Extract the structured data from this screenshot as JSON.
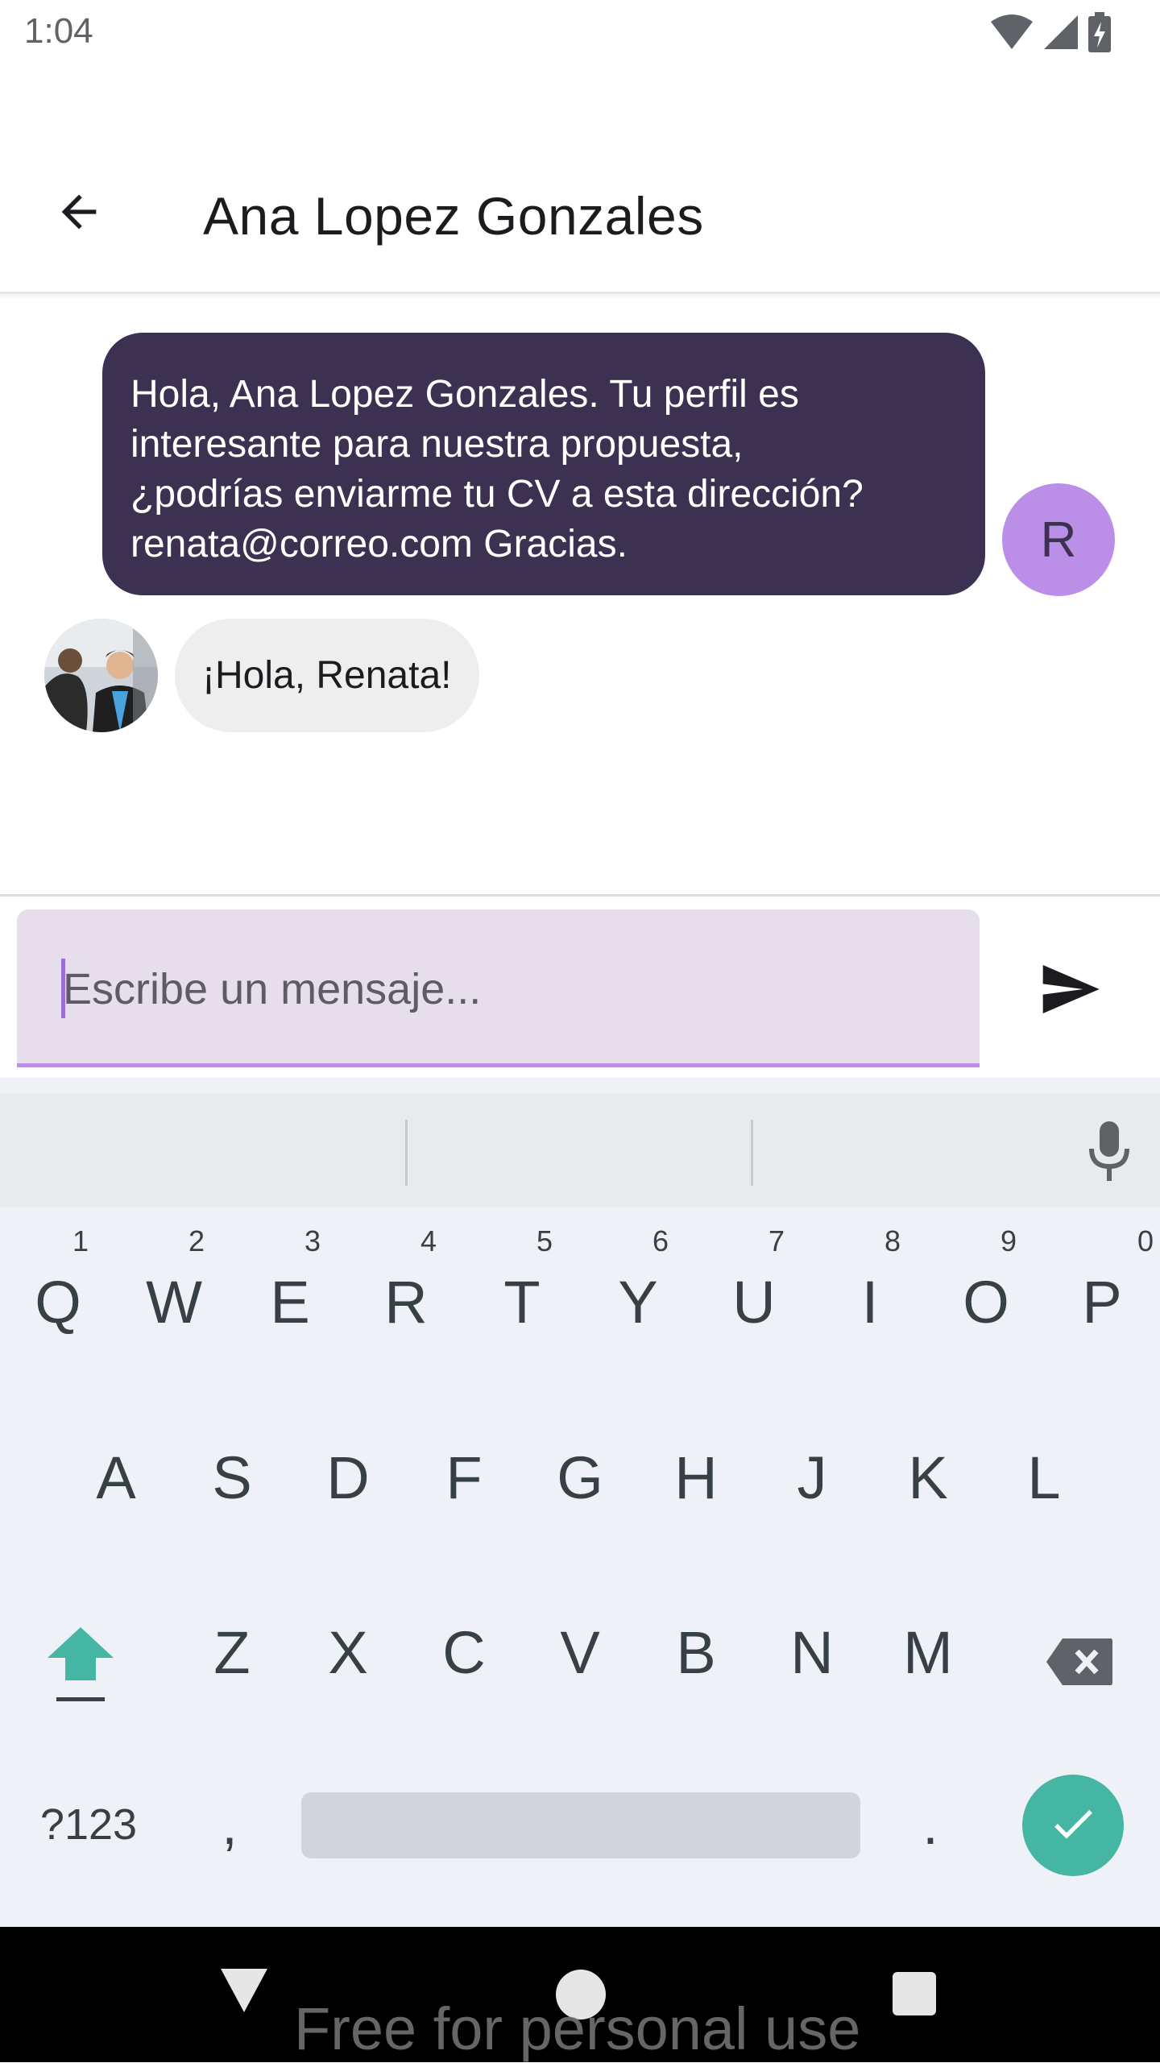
{
  "status_bar": {
    "time": "1:04"
  },
  "app_bar": {
    "title": "Ana Lopez Gonzales"
  },
  "messages": {
    "outgoing_lines": [
      "Hola, Ana Lopez Gonzales. Tu perfil es",
      "interesante para nuestra propuesta,",
      "¿podrías enviarme tu CV a esta dirección?",
      "renata@correo.com Gracias."
    ],
    "outgoing_avatar_letter": "R",
    "incoming": "¡Hola, Renata!"
  },
  "composer": {
    "placeholder": "Escribe un mensaje..."
  },
  "keyboard": {
    "row1": [
      {
        "key": "Q",
        "hint": "1"
      },
      {
        "key": "W",
        "hint": "2"
      },
      {
        "key": "E",
        "hint": "3"
      },
      {
        "key": "R",
        "hint": "4"
      },
      {
        "key": "T",
        "hint": "5"
      },
      {
        "key": "Y",
        "hint": "6"
      },
      {
        "key": "U",
        "hint": "7"
      },
      {
        "key": "I",
        "hint": "8"
      },
      {
        "key": "O",
        "hint": "9"
      },
      {
        "key": "P",
        "hint": "0"
      }
    ],
    "row2": [
      "A",
      "S",
      "D",
      "F",
      "G",
      "H",
      "J",
      "K",
      "L"
    ],
    "row3": [
      "Z",
      "X",
      "C",
      "V",
      "B",
      "N",
      "M"
    ],
    "symbols_label": "?123",
    "comma_label": ",",
    "period_label": "."
  },
  "watermark": "Free for personal use",
  "colors": {
    "accent": "#bb8fe8",
    "outgoing_bubble": "#3c3150",
    "incoming_bubble": "#eeeeee",
    "input_fill": "#e7deec",
    "keyboard_bg": "#eef1f5",
    "done_key": "#45b6a3"
  }
}
